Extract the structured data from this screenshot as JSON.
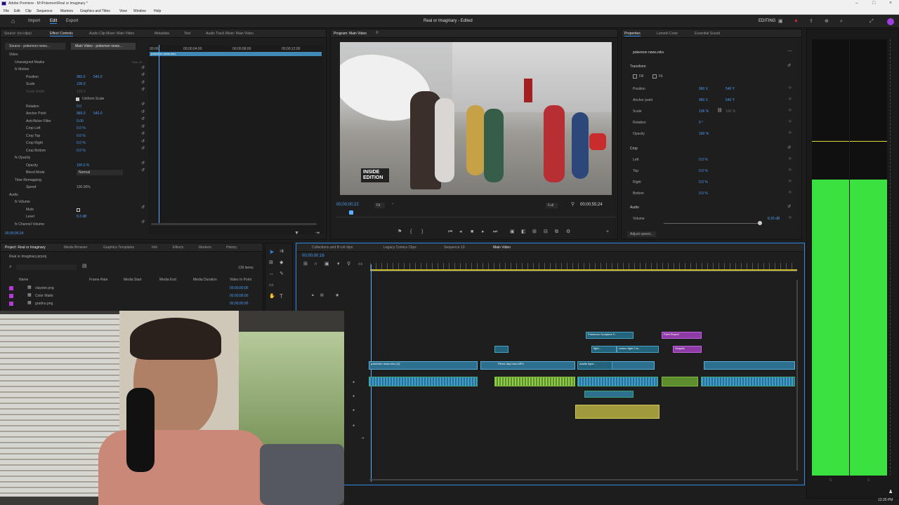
{
  "window": {
    "title": "Adobe Premiere - M:\\Pokemon\\Real or Imaginary *"
  },
  "menu": [
    "File",
    "Edit",
    "Clip",
    "Sequence",
    "Markers",
    "Graphics and Titles",
    "View",
    "Window",
    "Help"
  ],
  "workspace": {
    "tabs": [
      "Import",
      "Edit",
      "Export"
    ],
    "project_title": "Real or Imaginary - Edited",
    "mode": "EDITING"
  },
  "effect_controls": {
    "tabs": [
      "Source: (no clips)",
      "Effect Controls",
      "Audio Clip Mixer: Main Video",
      "Metadata",
      "Text",
      "Audio Track Mixer: Main Video"
    ],
    "source_label": "Source - pokemon news...",
    "clip_label": "Main Video - pokemon news...",
    "ruler": [
      "00:00",
      "00;00;04;00",
      "00;00;08;00",
      "00;00;12;00"
    ],
    "clip_name": "pokemon news.mkv",
    "rows": [
      {
        "label": "Video",
        "v1": "",
        "v2": ""
      },
      {
        "label": "Unassigned Masks",
        "v1": "",
        "v2": ""
      },
      {
        "label": "fx  Motion",
        "v1": "",
        "v2": ""
      },
      {
        "label": "Position",
        "v1": "960.0",
        "v2": "540.0"
      },
      {
        "label": "Scale",
        "v1": "136.0",
        "v2": ""
      },
      {
        "label": "Scale Width",
        "v1": "100.0",
        "v2": ""
      },
      {
        "label": "Uniform Scale",
        "v1": "",
        "v2": ""
      },
      {
        "label": "Rotation",
        "v1": "0.0",
        "v2": ""
      },
      {
        "label": "Anchor Point",
        "v1": "960.0",
        "v2": "540.0"
      },
      {
        "label": "Anti-flicker Filter",
        "v1": "0.00",
        "v2": ""
      },
      {
        "label": "Crop Left",
        "v1": "0.0 %",
        "v2": ""
      },
      {
        "label": "Crop Top",
        "v1": "0.0 %",
        "v2": ""
      },
      {
        "label": "Crop Right",
        "v1": "0.0 %",
        "v2": ""
      },
      {
        "label": "Crop Bottom",
        "v1": "0.0 %",
        "v2": ""
      },
      {
        "label": "fx  Opacity",
        "v1": "",
        "v2": ""
      },
      {
        "label": "Opacity",
        "v1": "100.0 %",
        "v2": ""
      },
      {
        "label": "Blend Mode",
        "v1": "Normal",
        "v2": ""
      },
      {
        "label": "Time Remapping",
        "v1": "",
        "v2": ""
      },
      {
        "label": "Speed",
        "v1": "100.00%",
        "v2": ""
      },
      {
        "label": "Audio",
        "v1": "",
        "v2": ""
      },
      {
        "label": "fx  Volume",
        "v1": "",
        "v2": ""
      },
      {
        "label": "Mute",
        "v1": "",
        "v2": ""
      },
      {
        "label": "Level",
        "v1": "8.3 dB",
        "v2": ""
      },
      {
        "label": "fx  Channel Volume",
        "v1": "",
        "v2": ""
      }
    ],
    "clear_all": "Clear all",
    "timecode": "00;00;00;24"
  },
  "program": {
    "title": "Program: Main Video",
    "timecode": "00;00;00;22",
    "fit": "Fit",
    "quality": "Full",
    "duration": "00;00;55;24",
    "watermark": "INSIDE EDITION"
  },
  "properties": {
    "tabs": [
      "Properties",
      "Lumetri Color",
      "Essential Sound"
    ],
    "clip": "pokemon news.mkv",
    "transform_label": "Transform",
    "fill": "Fill",
    "fit": "Fit",
    "rows": [
      {
        "label": "Position",
        "v1": "960 X",
        "v2": "540 Y"
      },
      {
        "label": "Anchor point",
        "v1": "960 X",
        "v2": "540 Y"
      },
      {
        "label": "Scale",
        "v1": "136 %",
        "v2": "100 %"
      },
      {
        "label": "Rotation",
        "v1": "0 °",
        "v2": ""
      },
      {
        "label": "Opacity",
        "v1": "100 %",
        "v2": ""
      }
    ],
    "crop_label": "Crop",
    "crop": [
      {
        "label": "Left",
        "v": "0.0 %"
      },
      {
        "label": "Top",
        "v": "0.0 %"
      },
      {
        "label": "Right",
        "v": "0.0 %"
      },
      {
        "label": "Bottom",
        "v": "0.0 %"
      }
    ],
    "audio_label": "Audio",
    "volume_label": "Volume",
    "volume_val": "8.26 dB",
    "adjust_speed": "Adjust speed..."
  },
  "project": {
    "tabs": [
      "Project: Real or Imaginary",
      "Media Browser",
      "Graphics Templates",
      "Info",
      "Effects",
      "Markers",
      "History"
    ],
    "file": "Real or Imaginary.prproj",
    "count": "139 items",
    "columns": [
      "Name",
      "Frame Rate",
      "Media Start",
      "Media End",
      "Media Duration",
      "Video In Point"
    ],
    "items": [
      {
        "name": "clayster.png",
        "tc": "00;00;00;00",
        "color": "#b33bd1"
      },
      {
        "name": "Color Matte",
        "tc": "00;00;00;00",
        "color": "#b33bd1"
      },
      {
        "name": "gradnu.png",
        "tc": "00;00;00;00",
        "color": "#b33bd1"
      }
    ]
  },
  "timeline": {
    "tabs": [
      "Collections and B roll clips",
      "Legacy Comics Clips",
      "Sequence 10",
      "Main Video"
    ],
    "timecode": "00;00;00;16",
    "clips": {
      "main": "pokemon news.mkv [V]",
      "pierre": "Pierre day Intro.MP4",
      "pokemon_sculpture": "Pokemon Sculpture F...",
      "field_report": "Field Report",
      "graphic": "Graphic",
      "adults": "Adults fight...",
      "costco": "costco fight 2.m...",
      "fight": "fight..."
    }
  },
  "clock": "12:25 PM",
  "colors": {
    "accent": "#2d8ceb",
    "meter_green": "#3be23f",
    "timecode_blue": "#4d9bf3"
  }
}
